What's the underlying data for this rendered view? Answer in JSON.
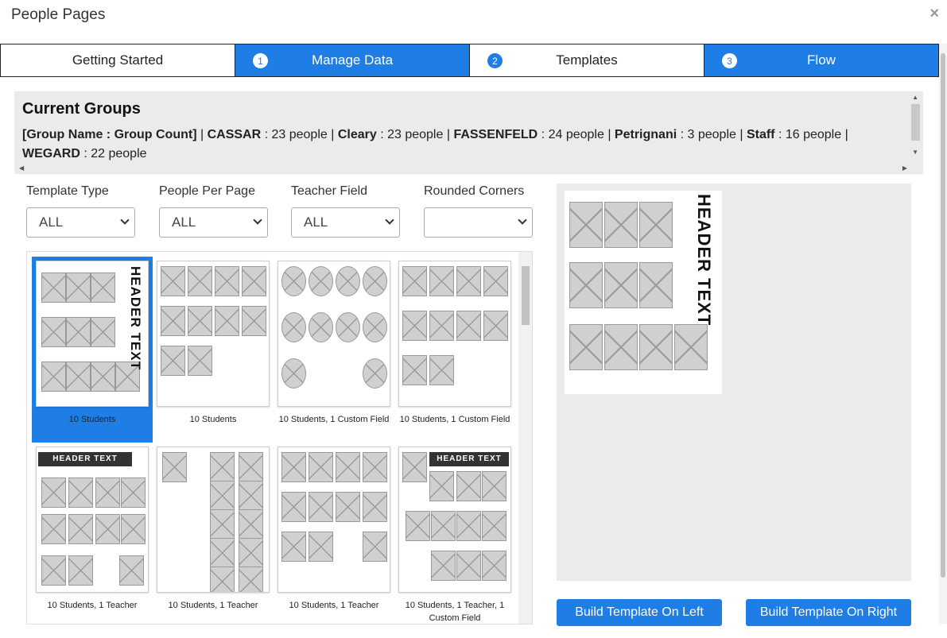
{
  "dialog": {
    "title": "People Pages",
    "close": "×"
  },
  "tabs": [
    {
      "num": "",
      "label": "Getting Started",
      "active": false
    },
    {
      "num": "1",
      "label": "Manage Data",
      "active": true
    },
    {
      "num": "2",
      "label": "Templates",
      "active": false
    },
    {
      "num": "3",
      "label": "Flow",
      "active": true
    }
  ],
  "groups": {
    "title": "Current Groups",
    "header": "[Group Name : Group Count]",
    "items": [
      {
        "name": "CASSAR",
        "count": "23 people"
      },
      {
        "name": "Cleary",
        "count": "23 people"
      },
      {
        "name": "FASSENFELD",
        "count": "24 people"
      },
      {
        "name": "Petrignani",
        "count": "3 people"
      },
      {
        "name": "Staff",
        "count": "16 people"
      },
      {
        "name": "WEGARD",
        "count": "22 people"
      }
    ]
  },
  "filters": {
    "template_type": {
      "label": "Template Type",
      "value": "ALL"
    },
    "people_per_page": {
      "label": "People Per Page",
      "value": "ALL"
    },
    "teacher_field": {
      "label": "Teacher Field",
      "value": "ALL"
    },
    "rounded_corners": {
      "label": "Rounded Corners",
      "value": ""
    }
  },
  "templates": [
    {
      "caption": "10 Students",
      "selected": true,
      "header": "HEADER TEXT"
    },
    {
      "caption": "10 Students",
      "selected": false
    },
    {
      "caption": "10 Students, 1 Custom Field",
      "selected": false
    },
    {
      "caption": "10 Students, 1 Custom Field",
      "selected": false
    },
    {
      "caption": "10 Students, 1 Teacher",
      "selected": false,
      "header": "HEADER TEXT"
    },
    {
      "caption": "10 Students, 1 Teacher",
      "selected": false
    },
    {
      "caption": "10 Students, 1 Teacher",
      "selected": false
    },
    {
      "caption": "10 Students, 1 Teacher, 1 Custom Field",
      "selected": false,
      "header": "HEADER TEXT"
    }
  ],
  "preview": {
    "header": "HEADER TEXT"
  },
  "buttons": {
    "build_left": "Build Template On Left",
    "build_right": "Build Template On Right"
  },
  "colors": {
    "accent": "#1e7ee6",
    "panel": "#ebebeb"
  }
}
